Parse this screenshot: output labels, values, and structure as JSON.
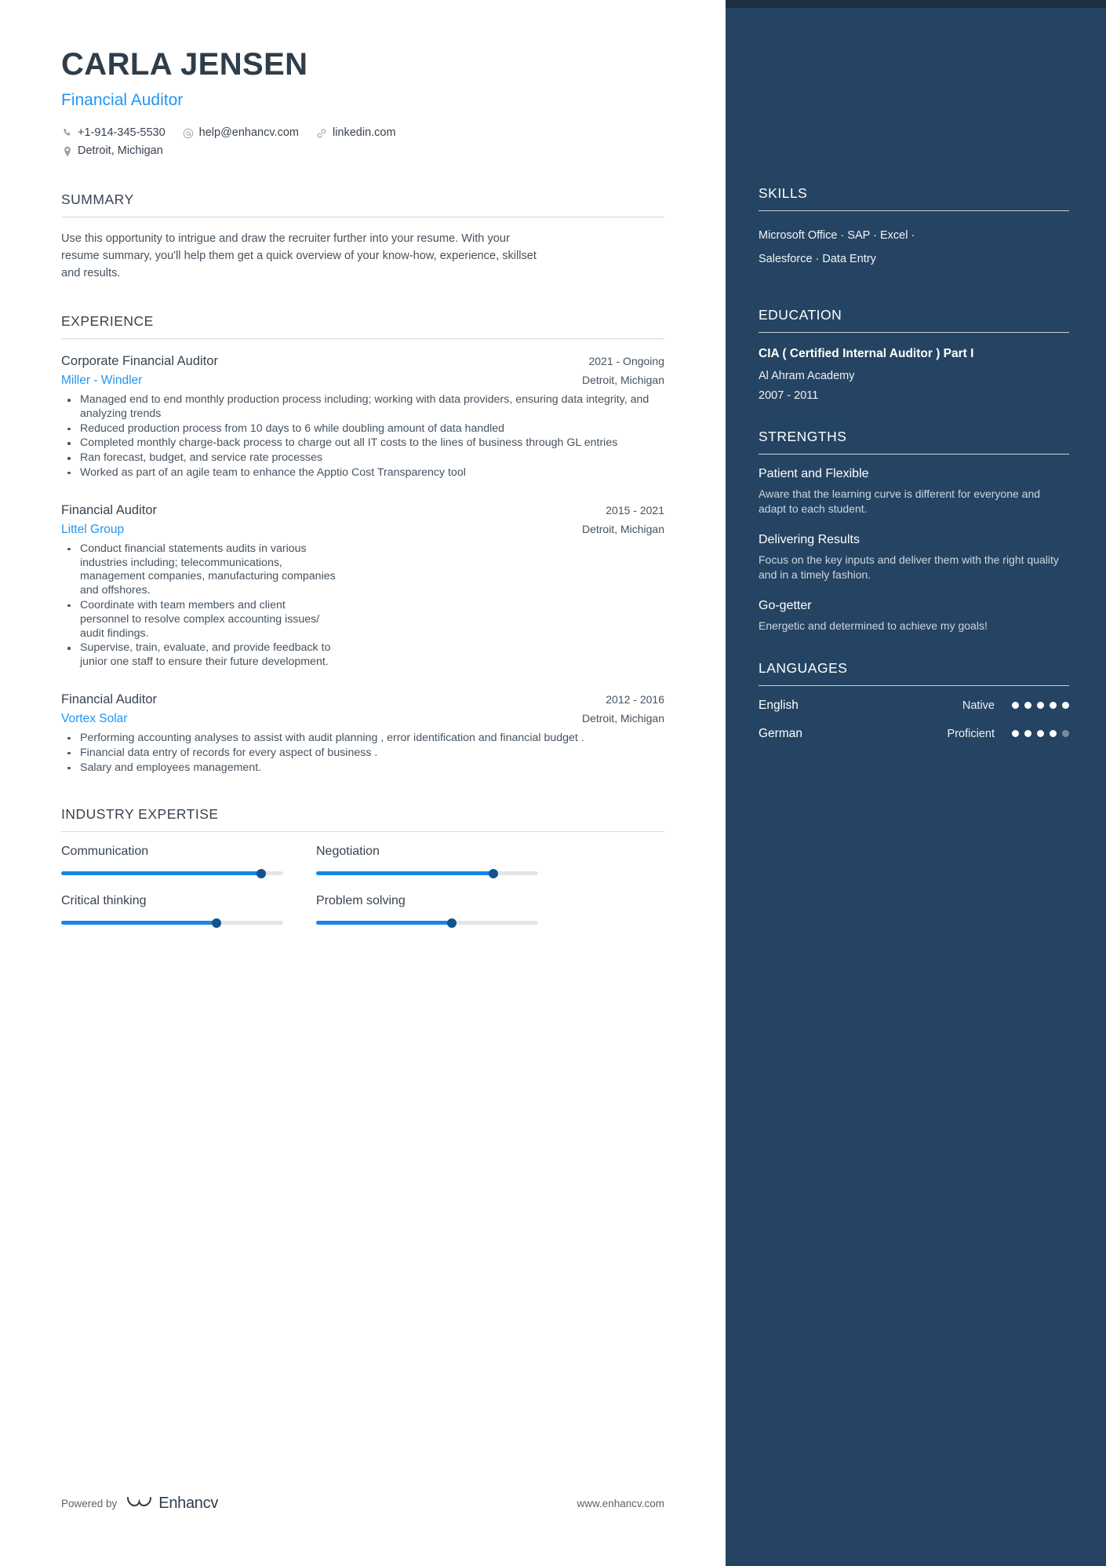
{
  "header": {
    "name": "CARLA JENSEN",
    "title": "Financial Auditor",
    "contacts": [
      {
        "icon": "phone-icon",
        "text": "+1-914-345-5530"
      },
      {
        "icon": "email-icon",
        "text": "help@enhancv.com"
      },
      {
        "icon": "link-icon",
        "text": "linkedin.com"
      },
      {
        "icon": "location-icon",
        "text": "Detroit, Michigan"
      }
    ]
  },
  "summary": {
    "heading": "SUMMARY",
    "text": "Use this opportunity to intrigue and draw the recruiter further into your resume. With your resume summary, you'll help them get a quick overview of your know-how, experience, skillset and results."
  },
  "experience": {
    "heading": "EXPERIENCE",
    "jobs": [
      {
        "position": "Corporate Financial Auditor",
        "date": "2021 - Ongoing",
        "company": "Miller - Windler",
        "location": "Detroit, Michigan",
        "narrow": false,
        "bullets": [
          "Managed end to end monthly production process including; working with data providers, ensuring data integrity, and analyzing trends",
          "Reduced production process from 10 days to 6 while doubling amount of data handled",
          "Completed monthly charge-back process to charge out all IT costs to the lines of business through GL entries",
          "Ran forecast, budget, and service rate processes",
          "Worked as part of an agile team to enhance the Apptio Cost Transparency tool"
        ]
      },
      {
        "position": "Financial Auditor",
        "date": "2015 - 2021",
        "company": "Littel Group",
        "location": "Detroit, Michigan",
        "narrow": true,
        "bullets": [
          "Conduct financial statements audits in various industries including; telecommunications, management companies, manufacturing companies and offshores.",
          "Coordinate with team members and client personnel to resolve complex accounting issues/ audit findings.",
          "Supervise, train, evaluate, and provide feedback to junior one staff to ensure their future development."
        ]
      },
      {
        "position": "Financial Auditor",
        "date": "2012 - 2016",
        "company": "Vortex Solar",
        "location": "Detroit, Michigan",
        "narrow": false,
        "bullets": [
          "Performing accounting analyses to assist with audit planning , error identification and financial budget .",
          "Financial data entry of records for every aspect of business .",
          "Salary and employees management."
        ]
      }
    ]
  },
  "industry_expertise": {
    "heading": "INDUSTRY EXPERTISE",
    "items": [
      {
        "label": "Communication",
        "value": 90
      },
      {
        "label": "Negotiation",
        "value": 80
      },
      {
        "label": "Critical thinking",
        "value": 70
      },
      {
        "label": "Problem solving",
        "value": 61
      }
    ]
  },
  "footer": {
    "powered_by": "Powered by",
    "brand": "Enhancv",
    "website": "www.enhancv.com"
  },
  "sidebar": {
    "skills": {
      "heading": "SKILLS",
      "lines": [
        "Microsoft Office · SAP · Excel ·",
        "Salesforce · Data Entry"
      ]
    },
    "education": {
      "heading": "EDUCATION",
      "degree": "CIA ( Certified Internal Auditor ) Part I",
      "school": "Al Ahram Academy",
      "date": "2007 - 2011"
    },
    "strengths": {
      "heading": "STRENGTHS",
      "items": [
        {
          "name": "Patient and Flexible",
          "desc": "Aware that the learning curve is different for everyone and adapt to each student."
        },
        {
          "name": "Delivering Results",
          "desc": "Focus on the key inputs and deliver them with the right quality and in a timely fashion."
        },
        {
          "name": "Go-getter",
          "desc": "Energetic and determined to achieve my goals!"
        }
      ]
    },
    "languages": {
      "heading": "LANGUAGES",
      "items": [
        {
          "name": "English",
          "level": "Native",
          "dots": 5,
          "total": 5
        },
        {
          "name": "German",
          "level": "Proficient",
          "dots": 4,
          "total": 5
        }
      ]
    }
  },
  "colors": {
    "accent": "#2196f3",
    "sidebar_bg": "#254463",
    "slider_fill": "#1487e8",
    "slider_thumb": "#12548f",
    "heading": "#38434f"
  }
}
